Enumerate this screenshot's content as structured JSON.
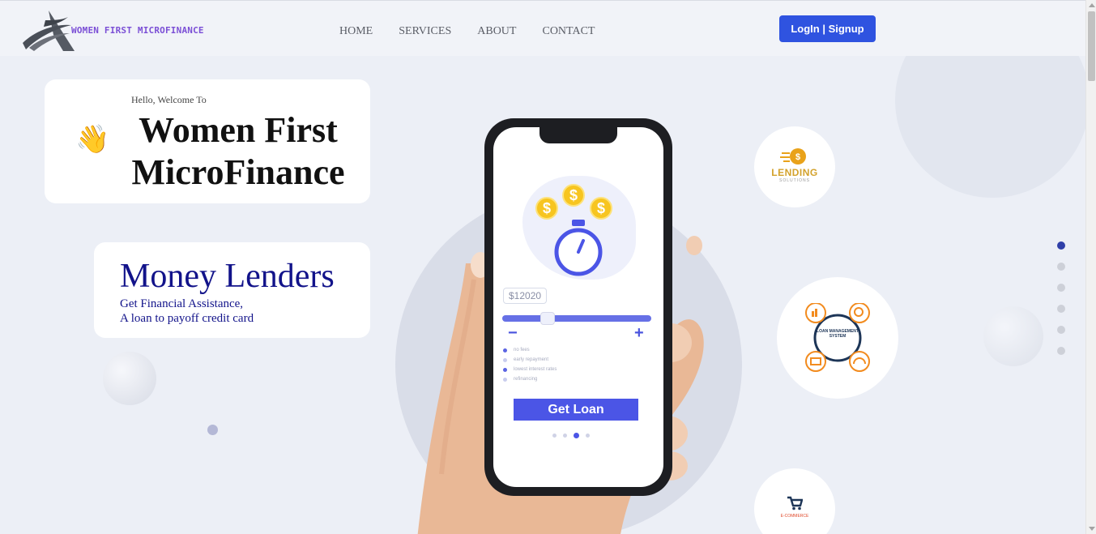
{
  "header": {
    "brand": "WOMEN FIRST MICROFINANCE",
    "nav": [
      "HOME",
      "SERVICES",
      "ABOUT",
      "CONTACT"
    ],
    "login_label": "LogIn | Signup"
  },
  "hero": {
    "hello": "Hello, Welcome To",
    "title_line1": "Women First",
    "title_line2": "MicroFinance",
    "wave_emoji": "👋",
    "money_title": "Money Lenders",
    "money_sub1": "Get Financial Assistance,",
    "money_sub2": "A loan to payoff credit card"
  },
  "phone_screen": {
    "coin_symbol": "$",
    "amount": "$12020",
    "minus": "−",
    "plus": "+",
    "options": [
      "no fees",
      "early repayment",
      "lowest interest rates",
      "refinancing"
    ],
    "cta": "Get Loan"
  },
  "services": {
    "lending": "LENDING",
    "lending_sub": "SOLUTIONS",
    "lms": "LOAN MANAGEMENT SYSTEM",
    "ecommerce": "E-COMMERCE"
  },
  "pager": {
    "count": 6,
    "active_index": 0
  },
  "colors": {
    "brand_purple": "#7b4fd6",
    "primary_blue": "#2f53e0",
    "money_navy": "#12138a",
    "lending_gold": "#d3a22c"
  }
}
